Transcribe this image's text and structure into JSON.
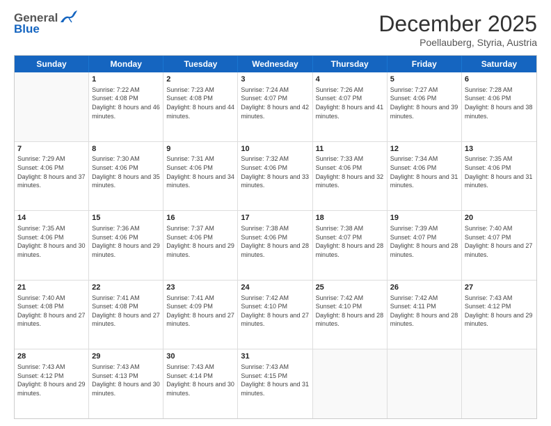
{
  "header": {
    "logo_general": "General",
    "logo_blue": "Blue",
    "month_title": "December 2025",
    "location": "Poellauberg, Styria, Austria"
  },
  "weekdays": [
    "Sunday",
    "Monday",
    "Tuesday",
    "Wednesday",
    "Thursday",
    "Friday",
    "Saturday"
  ],
  "rows": [
    [
      {
        "day": "",
        "sunrise": "",
        "sunset": "",
        "daylight": ""
      },
      {
        "day": "1",
        "sunrise": "Sunrise: 7:22 AM",
        "sunset": "Sunset: 4:08 PM",
        "daylight": "Daylight: 8 hours and 46 minutes."
      },
      {
        "day": "2",
        "sunrise": "Sunrise: 7:23 AM",
        "sunset": "Sunset: 4:08 PM",
        "daylight": "Daylight: 8 hours and 44 minutes."
      },
      {
        "day": "3",
        "sunrise": "Sunrise: 7:24 AM",
        "sunset": "Sunset: 4:07 PM",
        "daylight": "Daylight: 8 hours and 42 minutes."
      },
      {
        "day": "4",
        "sunrise": "Sunrise: 7:26 AM",
        "sunset": "Sunset: 4:07 PM",
        "daylight": "Daylight: 8 hours and 41 minutes."
      },
      {
        "day": "5",
        "sunrise": "Sunrise: 7:27 AM",
        "sunset": "Sunset: 4:06 PM",
        "daylight": "Daylight: 8 hours and 39 minutes."
      },
      {
        "day": "6",
        "sunrise": "Sunrise: 7:28 AM",
        "sunset": "Sunset: 4:06 PM",
        "daylight": "Daylight: 8 hours and 38 minutes."
      }
    ],
    [
      {
        "day": "7",
        "sunrise": "Sunrise: 7:29 AM",
        "sunset": "Sunset: 4:06 PM",
        "daylight": "Daylight: 8 hours and 37 minutes."
      },
      {
        "day": "8",
        "sunrise": "Sunrise: 7:30 AM",
        "sunset": "Sunset: 4:06 PM",
        "daylight": "Daylight: 8 hours and 35 minutes."
      },
      {
        "day": "9",
        "sunrise": "Sunrise: 7:31 AM",
        "sunset": "Sunset: 4:06 PM",
        "daylight": "Daylight: 8 hours and 34 minutes."
      },
      {
        "day": "10",
        "sunrise": "Sunrise: 7:32 AM",
        "sunset": "Sunset: 4:06 PM",
        "daylight": "Daylight: 8 hours and 33 minutes."
      },
      {
        "day": "11",
        "sunrise": "Sunrise: 7:33 AM",
        "sunset": "Sunset: 4:06 PM",
        "daylight": "Daylight: 8 hours and 32 minutes."
      },
      {
        "day": "12",
        "sunrise": "Sunrise: 7:34 AM",
        "sunset": "Sunset: 4:06 PM",
        "daylight": "Daylight: 8 hours and 31 minutes."
      },
      {
        "day": "13",
        "sunrise": "Sunrise: 7:35 AM",
        "sunset": "Sunset: 4:06 PM",
        "daylight": "Daylight: 8 hours and 31 minutes."
      }
    ],
    [
      {
        "day": "14",
        "sunrise": "Sunrise: 7:35 AM",
        "sunset": "Sunset: 4:06 PM",
        "daylight": "Daylight: 8 hours and 30 minutes."
      },
      {
        "day": "15",
        "sunrise": "Sunrise: 7:36 AM",
        "sunset": "Sunset: 4:06 PM",
        "daylight": "Daylight: 8 hours and 29 minutes."
      },
      {
        "day": "16",
        "sunrise": "Sunrise: 7:37 AM",
        "sunset": "Sunset: 4:06 PM",
        "daylight": "Daylight: 8 hours and 29 minutes."
      },
      {
        "day": "17",
        "sunrise": "Sunrise: 7:38 AM",
        "sunset": "Sunset: 4:06 PM",
        "daylight": "Daylight: 8 hours and 28 minutes."
      },
      {
        "day": "18",
        "sunrise": "Sunrise: 7:38 AM",
        "sunset": "Sunset: 4:07 PM",
        "daylight": "Daylight: 8 hours and 28 minutes."
      },
      {
        "day": "19",
        "sunrise": "Sunrise: 7:39 AM",
        "sunset": "Sunset: 4:07 PM",
        "daylight": "Daylight: 8 hours and 28 minutes."
      },
      {
        "day": "20",
        "sunrise": "Sunrise: 7:40 AM",
        "sunset": "Sunset: 4:07 PM",
        "daylight": "Daylight: 8 hours and 27 minutes."
      }
    ],
    [
      {
        "day": "21",
        "sunrise": "Sunrise: 7:40 AM",
        "sunset": "Sunset: 4:08 PM",
        "daylight": "Daylight: 8 hours and 27 minutes."
      },
      {
        "day": "22",
        "sunrise": "Sunrise: 7:41 AM",
        "sunset": "Sunset: 4:08 PM",
        "daylight": "Daylight: 8 hours and 27 minutes."
      },
      {
        "day": "23",
        "sunrise": "Sunrise: 7:41 AM",
        "sunset": "Sunset: 4:09 PM",
        "daylight": "Daylight: 8 hours and 27 minutes."
      },
      {
        "day": "24",
        "sunrise": "Sunrise: 7:42 AM",
        "sunset": "Sunset: 4:10 PM",
        "daylight": "Daylight: 8 hours and 27 minutes."
      },
      {
        "day": "25",
        "sunrise": "Sunrise: 7:42 AM",
        "sunset": "Sunset: 4:10 PM",
        "daylight": "Daylight: 8 hours and 28 minutes."
      },
      {
        "day": "26",
        "sunrise": "Sunrise: 7:42 AM",
        "sunset": "Sunset: 4:11 PM",
        "daylight": "Daylight: 8 hours and 28 minutes."
      },
      {
        "day": "27",
        "sunrise": "Sunrise: 7:43 AM",
        "sunset": "Sunset: 4:12 PM",
        "daylight": "Daylight: 8 hours and 29 minutes."
      }
    ],
    [
      {
        "day": "28",
        "sunrise": "Sunrise: 7:43 AM",
        "sunset": "Sunset: 4:12 PM",
        "daylight": "Daylight: 8 hours and 29 minutes."
      },
      {
        "day": "29",
        "sunrise": "Sunrise: 7:43 AM",
        "sunset": "Sunset: 4:13 PM",
        "daylight": "Daylight: 8 hours and 30 minutes."
      },
      {
        "day": "30",
        "sunrise": "Sunrise: 7:43 AM",
        "sunset": "Sunset: 4:14 PM",
        "daylight": "Daylight: 8 hours and 30 minutes."
      },
      {
        "day": "31",
        "sunrise": "Sunrise: 7:43 AM",
        "sunset": "Sunset: 4:15 PM",
        "daylight": "Daylight: 8 hours and 31 minutes."
      },
      {
        "day": "",
        "sunrise": "",
        "sunset": "",
        "daylight": ""
      },
      {
        "day": "",
        "sunrise": "",
        "sunset": "",
        "daylight": ""
      },
      {
        "day": "",
        "sunrise": "",
        "sunset": "",
        "daylight": ""
      }
    ]
  ]
}
